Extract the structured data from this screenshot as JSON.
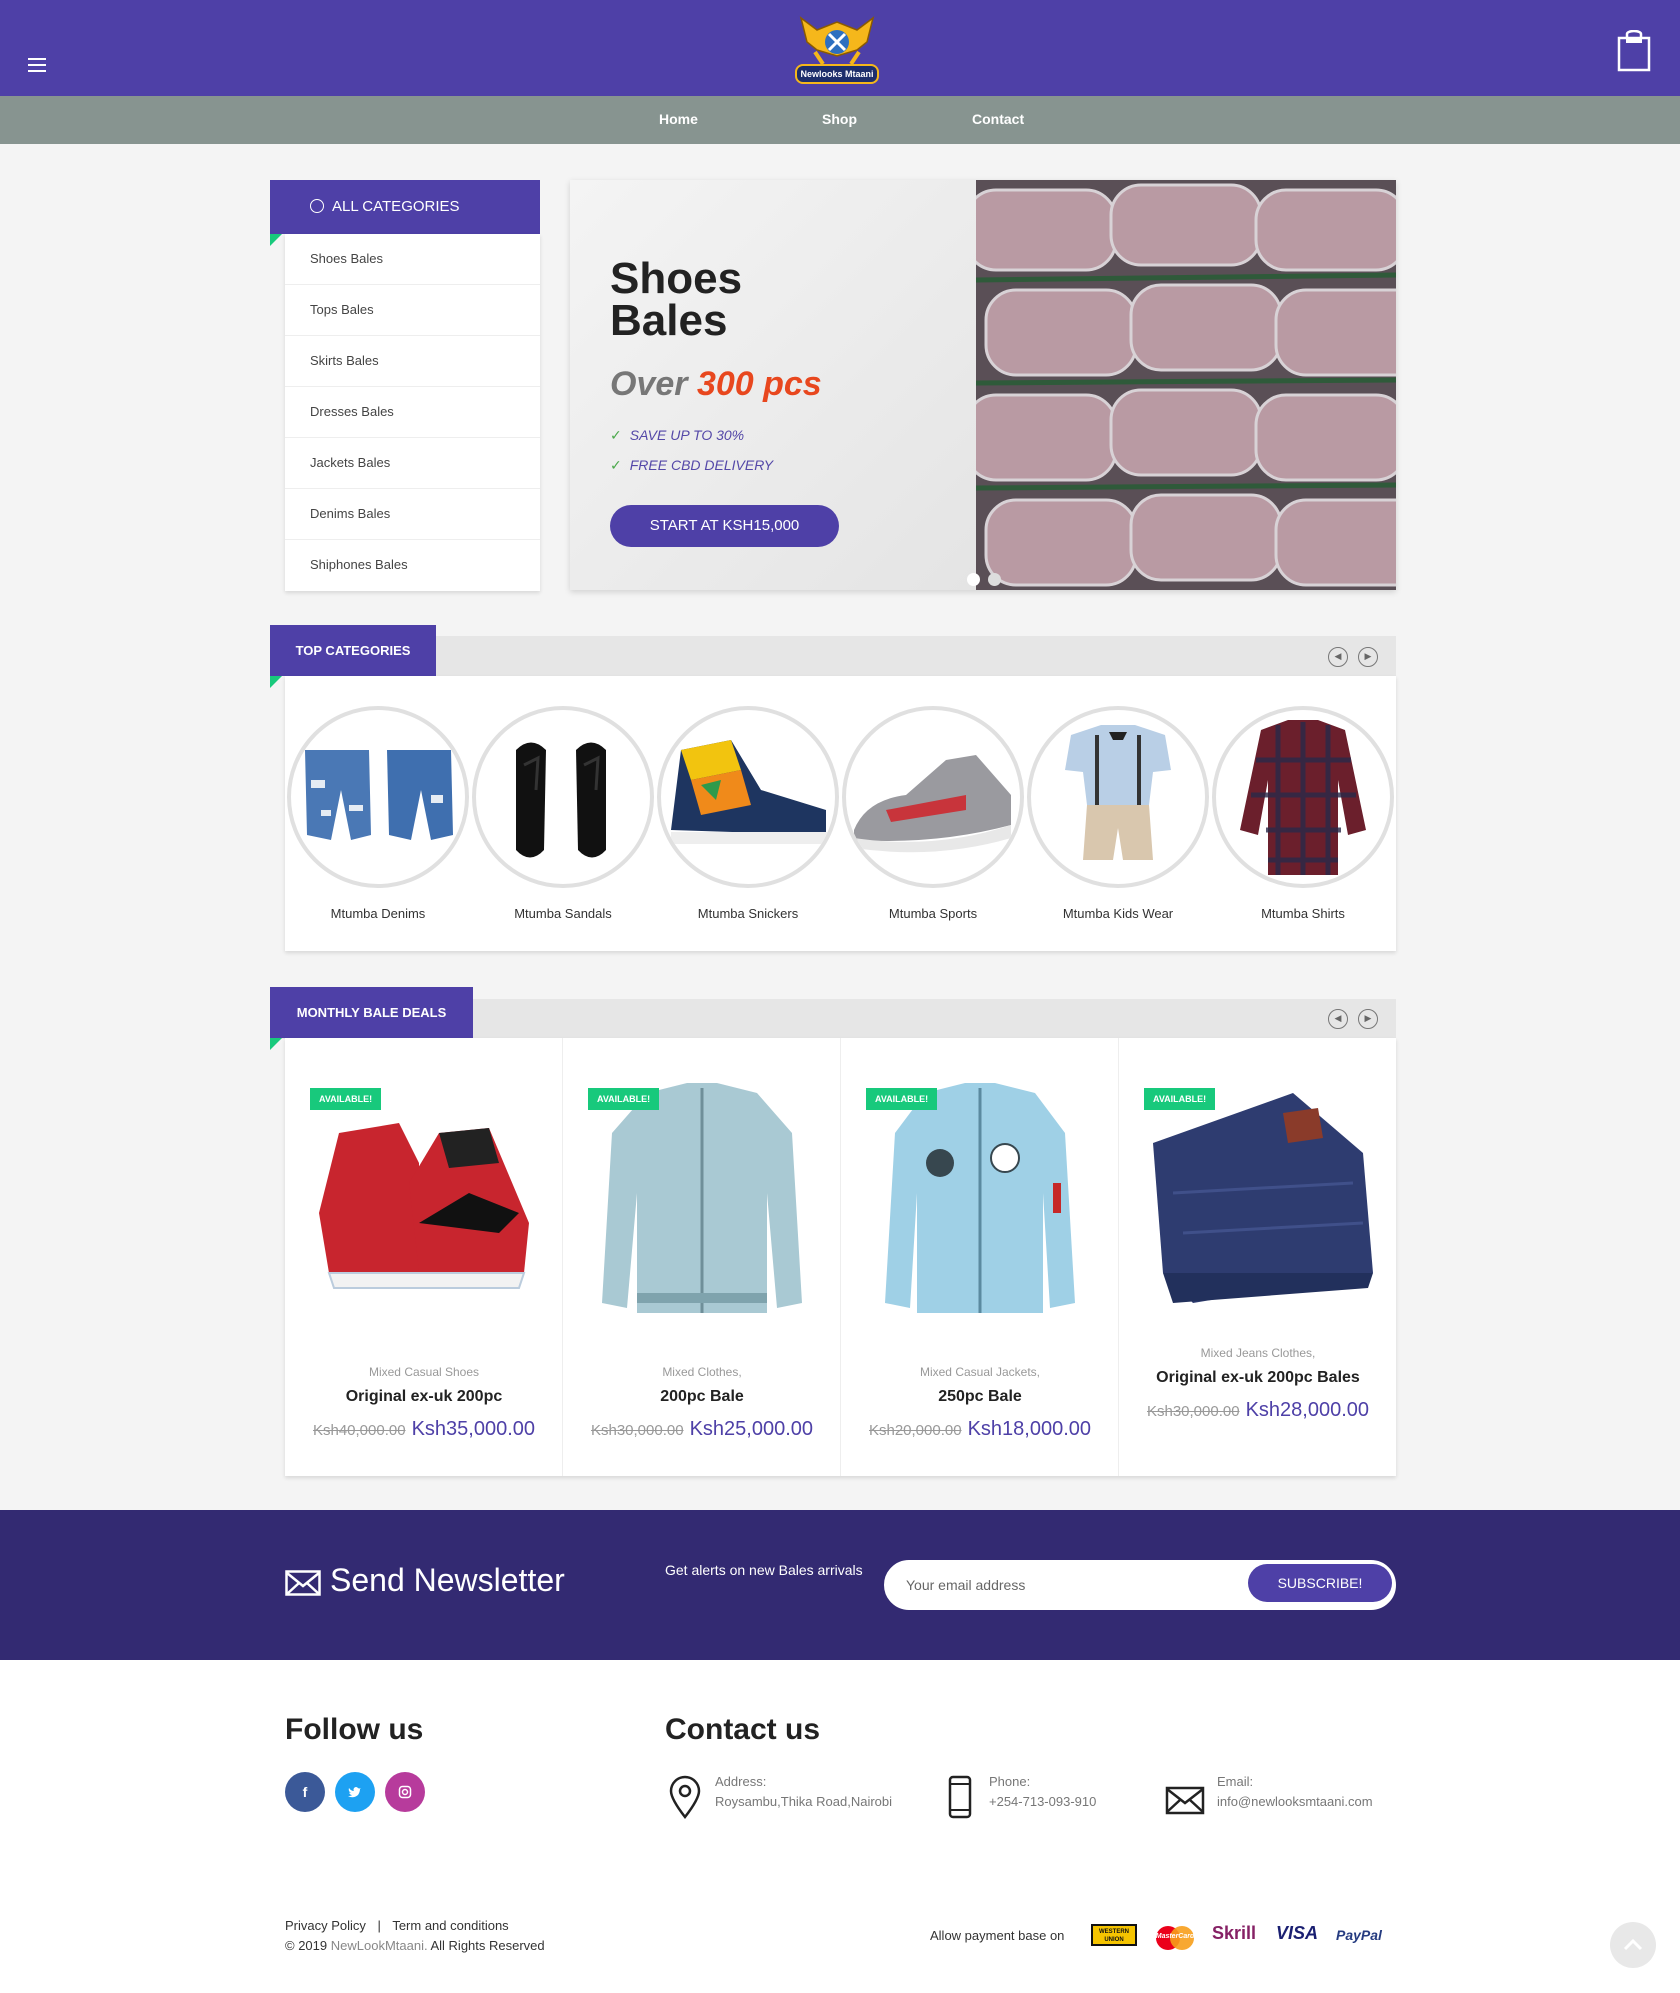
{
  "header": {
    "logo_text": "Newlooks Mtaani",
    "nav": [
      "Home",
      "Shop",
      "Contact"
    ]
  },
  "sidebar": {
    "title": "ALL CATEGORIES",
    "items": [
      "Shoes Bales",
      "Tops Bales",
      "Skirts Bales",
      "Dresses Bales",
      "Jackets Bales",
      "Denims Bales",
      "Shiphones Bales"
    ]
  },
  "hero": {
    "title": "Shoes Bales",
    "sub_prefix": "Over",
    "sub_highlight": "300 pcs",
    "features": [
      "SAVE UP TO 30%",
      "FREE CBD DELIVERY"
    ],
    "button": "START AT KSH15,000"
  },
  "top_categories": {
    "title": "TOP CATEGORIES",
    "items": [
      "Mtumba Denims",
      "Mtumba Sandals",
      "Mtumba Snickers",
      "Mtumba Sports",
      "Mtumba Kids Wear",
      "Mtumba Shirts"
    ]
  },
  "deals": {
    "title": "MONTHLY BALE DEALS",
    "badge": "AVAILABLE!",
    "items": [
      {
        "category": "Mixed Casual Shoes",
        "name": "Original ex-uk 200pc",
        "old_price": "Ksh40,000.00",
        "new_price": "Ksh35,000.00"
      },
      {
        "category": "Mixed Clothes,",
        "name": "200pc Bale",
        "old_price": "Ksh30,000.00",
        "new_price": "Ksh25,000.00"
      },
      {
        "category": "Mixed Casual Jackets,",
        "name": "250pc Bale",
        "old_price": "Ksh20,000.00",
        "new_price": "Ksh18,000.00"
      },
      {
        "category": "Mixed Jeans Clothes,",
        "name": "Original ex-uk 200pc Bales",
        "old_price": "Ksh30,000.00",
        "new_price": "Ksh28,000.00"
      }
    ]
  },
  "newsletter": {
    "title": "Send Newsletter",
    "text": "Get alerts on new Bales arrivals",
    "placeholder": "Your email address",
    "button": "SUBSCRIBE!"
  },
  "footer": {
    "follow_title": "Follow us",
    "contact_title": "Contact us",
    "address_label": "Address:",
    "address": "Roysambu,Thika Road,Nairobi",
    "phone_label": "Phone:",
    "phone": "+254-713-093-910",
    "email_label": "Email:",
    "email": "info@newlooksmtaani.com",
    "privacy": "Privacy Policy",
    "sep": "|",
    "terms": "Term and conditions",
    "copy_prefix": "© 2019",
    "copy_brand": "NewLookMtaani.",
    "copy_suffix": "All Rights Reserved",
    "pay_text": "Allow payment base on",
    "pay": [
      "WESTERN UNION",
      "MasterCard",
      "Skrill",
      "VISA",
      "PayPal"
    ]
  },
  "colors": {
    "primary": "#4e40a7",
    "nav_gray": "#879490",
    "accent_green": "#18c97c",
    "hero_highlight": "#e8471e",
    "newsletter_bg": "#332a72"
  }
}
